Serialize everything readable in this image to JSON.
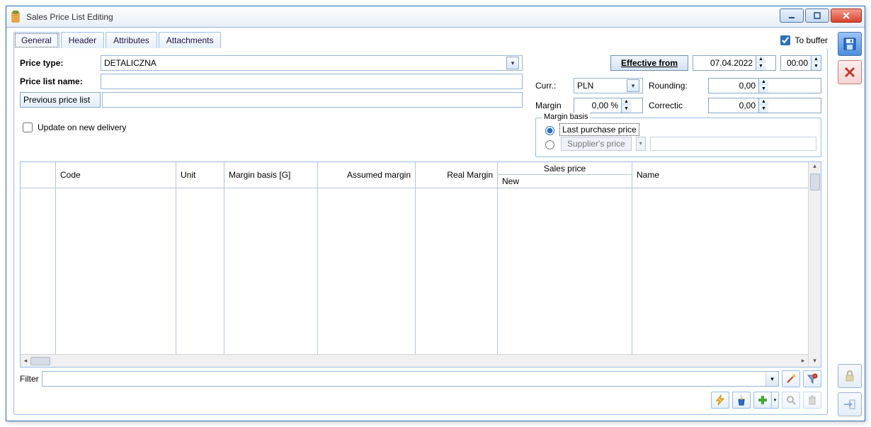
{
  "window": {
    "title": "Sales Price List Editing"
  },
  "tabs": [
    "General",
    "Header",
    "Attributes",
    "Attachments"
  ],
  "active_tab": 0,
  "to_buffer": {
    "label": "To buffer",
    "checked": true
  },
  "form": {
    "price_type": {
      "label": "Price type:",
      "value": "DETALICZNA"
    },
    "price_list_name": {
      "label": "Price list name:",
      "value": ""
    },
    "previous_btn": "Previous price list",
    "previous_value": ""
  },
  "right": {
    "effective_from_btn": "Effective from",
    "date": "07.04.2022",
    "time": "00:00",
    "curr_label": "Curr.:",
    "curr_value": "PLN",
    "margin_label": "Margin",
    "margin_value": "0,00 %",
    "rounding_label": "Rounding:",
    "rounding_value": "0,00",
    "correctic_label": "Correctic",
    "correctic_value": "0,00",
    "margin_basis": {
      "legend": "Margin basis",
      "opt1": "Last purchase price",
      "opt2_btn": "Supplier's price",
      "selected": "opt1",
      "supplier_value": ""
    }
  },
  "update_on_delivery": {
    "label": "Update on new delivery",
    "checked": false
  },
  "grid": {
    "cols": {
      "row_handle_w": 50,
      "code": "Code",
      "code_w": 170,
      "unit": "Unit",
      "unit_w": 68,
      "margin_basis": "Margin basis [G]",
      "mb_w": 132,
      "assumed_margin": "Assumed margin",
      "am_w": 138,
      "real_margin": "Real Margin",
      "rm_w": 116,
      "sales_price_top": "Sales price",
      "sales_price_new": "New",
      "sp_w": 190,
      "name": "Name",
      "name_w": 250
    }
  },
  "filter": {
    "label": "Filter",
    "value": ""
  },
  "icons": {
    "wand": "wand",
    "funnel": "funnel",
    "bolt": "bolt",
    "fire": "fire",
    "plus": "plus",
    "search": "search",
    "trash": "trash",
    "save": "save",
    "close_x": "close",
    "lock": "lock",
    "arrow_in": "arrow_in"
  }
}
